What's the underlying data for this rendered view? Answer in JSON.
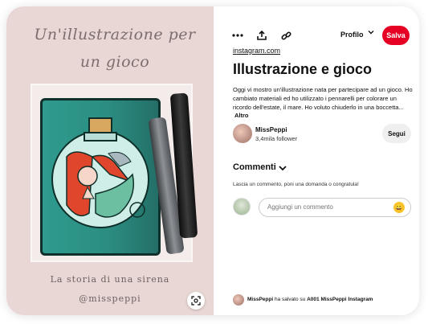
{
  "image_panel": {
    "script_title": "Un'illustrazione per un gioco",
    "caption_line1": "La storia di una sirena",
    "caption_line2": "@misspeppi"
  },
  "toolbar": {
    "more_icon": "more-horizontal-icon",
    "share_icon": "share-icon",
    "link_icon": "link-icon",
    "profile_label": "Profilo",
    "save_label": "Salva",
    "save_color": "#e60023"
  },
  "pin": {
    "source": "instagram.com",
    "title": "Illustrazione e gioco",
    "description": "Oggi vi mostro un'illustrazione nata per partecipare ad un gioco. Ho cambiato materiali ed ho utilizzato i pennarelli per colorare un ricordo dell'estate, il mare. Ho voluto chiuderlo in una boccetta...",
    "more_label": "Altro"
  },
  "creator": {
    "name": "MissPeppi",
    "followers": "3,4mila follower",
    "follow_label": "Segui"
  },
  "comments": {
    "heading": "Commenti",
    "hint": "Lascia un commento, poni una domanda o congratula!",
    "input_placeholder": "Aggiungi un commento",
    "emoji": "😀"
  },
  "saved": {
    "user": "MissPeppi",
    "verb": "ha salvato su",
    "board": "A001 MissPeppi Instagram"
  }
}
